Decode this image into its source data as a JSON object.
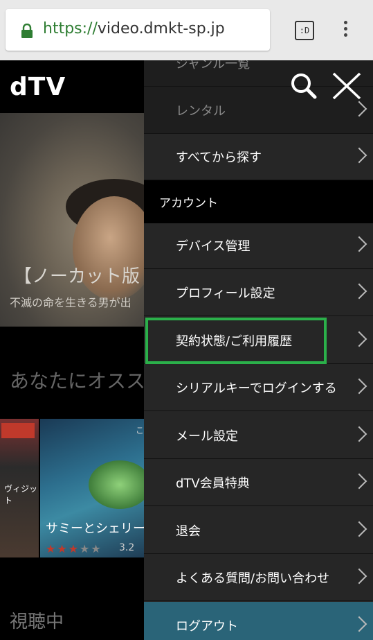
{
  "browser": {
    "url_scheme": "https://",
    "url_host": "video.dmkt-sp.jp",
    "tab_count_label": ":D"
  },
  "app": {
    "logo": "dTV"
  },
  "background": {
    "hero_title": "【ノーカット版",
    "hero_subtitle": "不滅の命を生きる男が出",
    "recommend_title": "あなたにオスス",
    "thumb1_text": "ヴィジット",
    "thumb2_title": "サミーとシェリー",
    "thumb2_rating": "3.2",
    "thumb2_corner": "こ",
    "watching_title": "視聴中"
  },
  "menu": {
    "partial_top": "ジャンル一覧",
    "rental": "レンタル",
    "search_all": "すべてから探す",
    "account_section": "アカウント",
    "items": [
      "デバイス管理",
      "プロフィール設定",
      "契約状態/ご利用履歴",
      "シリアルキーでログインする",
      "メール設定",
      "dTV会員特典",
      "退会",
      "よくある質問/お問い合わせ",
      "ログアウト"
    ]
  },
  "colors": {
    "highlight": "#2bb04a",
    "logout_bg": "#2a6478",
    "url_green": "#2e7d32"
  }
}
